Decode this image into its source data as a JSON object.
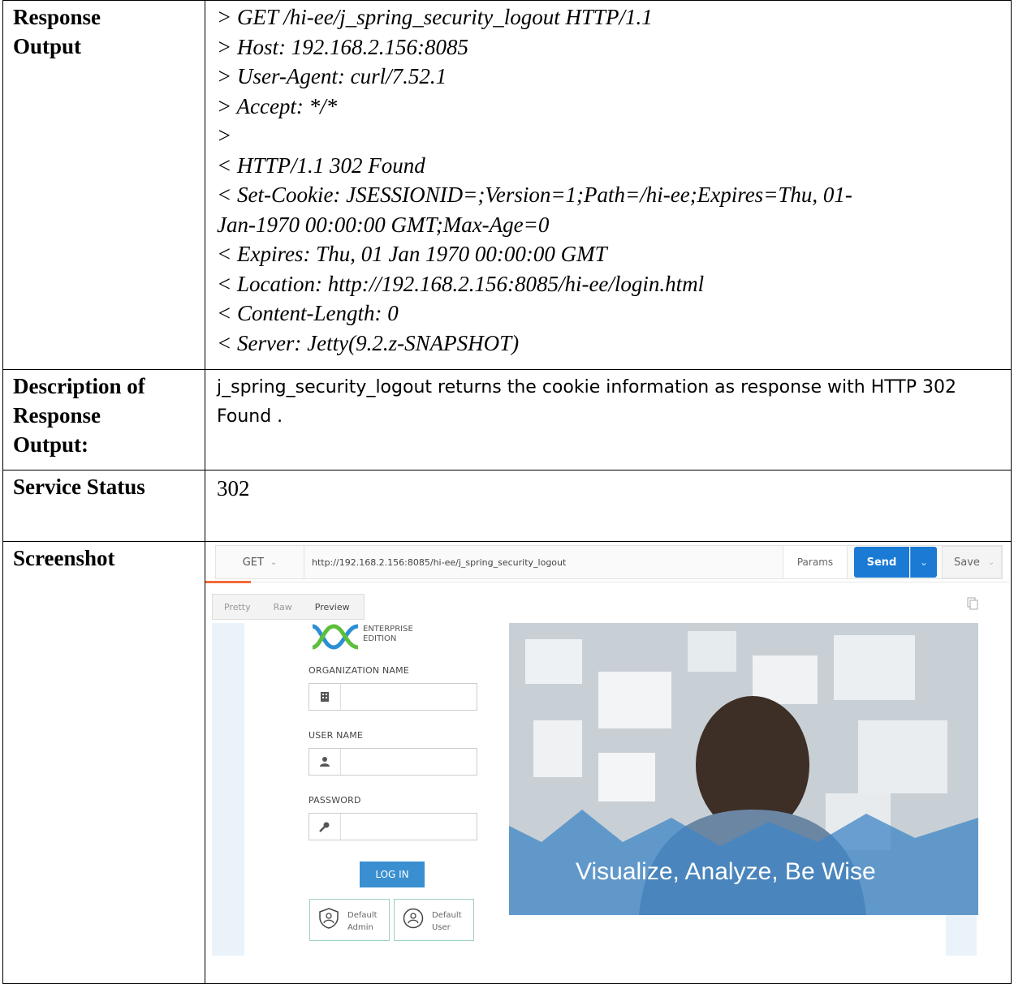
{
  "rows": {
    "response_output": {
      "label_line1": "Response",
      "label_line2": "Output",
      "lines": [
        "> GET /hi-ee/j_spring_security_logout HTTP/1.1",
        "> Host: 192.168.2.156:8085",
        "> User-Agent: curl/7.52.1",
        "> Accept: */*",
        ">",
        "< HTTP/1.1 302 Found",
        "< Set-Cookie: JSESSIONID=;Version=1;Path=/hi-ee;Expires=Thu, 01-",
        "Jan-1970 00:00:00 GMT;Max-Age=0",
        "< Expires: Thu, 01 Jan 1970 00:00:00 GMT",
        "< Location: http://192.168.2.156:8085/hi-ee/login.html",
        "< Content-Length: 0",
        "< Server: Jetty(9.2.z-SNAPSHOT)"
      ]
    },
    "description": {
      "label_line1": "Description of",
      "label_line2": "Response",
      "label_line3": "Output:",
      "text": "j_spring_security_logout returns the cookie information as response with HTTP 302 Found ."
    },
    "service_status": {
      "label": "Service Status",
      "value": "302"
    },
    "screenshot": {
      "label": "Screenshot"
    }
  },
  "shot": {
    "method": "GET",
    "url": "http://192.168.2.156:8085/hi-ee/j_spring_security_logout",
    "params": "Params",
    "send": "Send",
    "save": "Save",
    "tabs": [
      "Pretty",
      "Raw",
      "Preview"
    ],
    "logo_line1": "ENTERPRISE",
    "logo_line2": "EDITION",
    "org_label": "ORGANIZATION NAME",
    "user_label": "USER NAME",
    "pass_label": "PASSWORD",
    "login": "LOG IN",
    "admin_line1": "Default",
    "admin_line2": "Admin",
    "user_line1": "Default",
    "user_line2": "User",
    "hero_text": "Visualize, Analyze, Be Wise",
    "colors": {
      "send": "#1a7ad4",
      "accent_tab": "#f26b3a",
      "login": "#3a8fd0"
    }
  }
}
